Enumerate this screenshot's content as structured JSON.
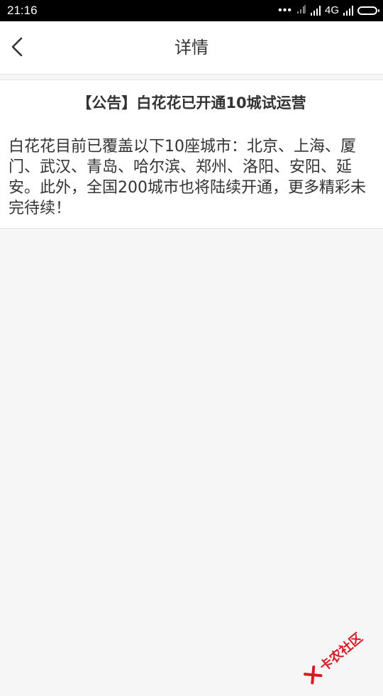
{
  "status_bar": {
    "time": "21:16",
    "dots": "•••",
    "network": "4G",
    "icons": [
      "signal-off-icon",
      "signal-icon",
      "signal-icon-2",
      "battery-icon"
    ]
  },
  "nav": {
    "back_icon": "chevron-left-icon",
    "title": "详情"
  },
  "article": {
    "title": "【公告】白花花已开通10城试运营",
    "body": "白花花目前已覆盖以下10座城市：北京、上海、厦门、武汉、青岛、哈尔滨、郑州、洛阳、安阳、延安。此外，全国200城市也将陆续开通，更多精彩未完待续！"
  },
  "watermark": {
    "text": "卡农社区",
    "logo_icon": "kanong-logo-icon",
    "color": "#d61b22"
  },
  "colors": {
    "page_bg": "#f6f6f6",
    "card_bg": "#ffffff",
    "text": "#333333",
    "status_bar_bg": "#000000"
  }
}
